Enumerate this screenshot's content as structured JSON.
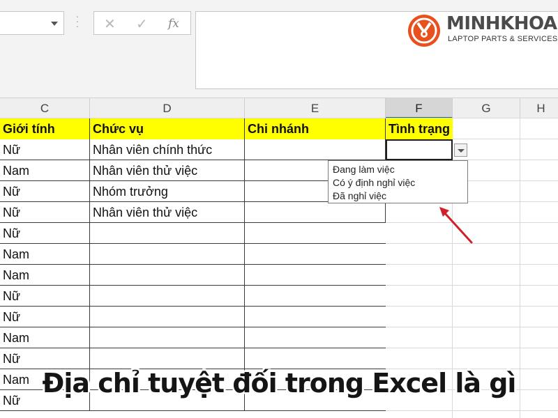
{
  "formula_bar": {
    "cancel_icon": "✕",
    "enter_icon": "✓",
    "fx_label": "fx",
    "formula_value": ""
  },
  "logo": {
    "name": "MINHKHOA",
    "tagline": "LAPTOP PARTS & SERVICES",
    "brand_color": "#e8501e"
  },
  "columns": [
    "C",
    "D",
    "E",
    "F",
    "G",
    "H"
  ],
  "selected_column": "F",
  "table": {
    "headers": {
      "c": "Giới tính",
      "d": "Chức vụ",
      "e": "Chi nhánh",
      "f": "Tình trạng"
    },
    "header_fill": "#ffff00",
    "rows": [
      {
        "c": "Nữ",
        "d": "Nhân viên chính thức"
      },
      {
        "c": "Nam",
        "d": "Nhân viên thử việc"
      },
      {
        "c": "Nữ",
        "d": "Nhóm trưởng"
      },
      {
        "c": "Nữ",
        "d": "Nhân viên thử việc"
      },
      {
        "c": "Nữ",
        "d": ""
      },
      {
        "c": "Nam",
        "d": ""
      },
      {
        "c": "Nam",
        "d": ""
      },
      {
        "c": "Nữ",
        "d": ""
      },
      {
        "c": "Nữ",
        "d": ""
      },
      {
        "c": "Nam",
        "d": ""
      },
      {
        "c": "Nữ",
        "d": ""
      },
      {
        "c": "Nam",
        "d": ""
      },
      {
        "c": "Nữ",
        "d": ""
      }
    ]
  },
  "dropdown": {
    "options": [
      "Đang làm việc",
      "Có ý định nghỉ việc",
      "Đã nghỉ việc"
    ]
  },
  "annotation_color": "#d0202a",
  "caption": "Địa chỉ tuyệt đối trong Excel là gì"
}
